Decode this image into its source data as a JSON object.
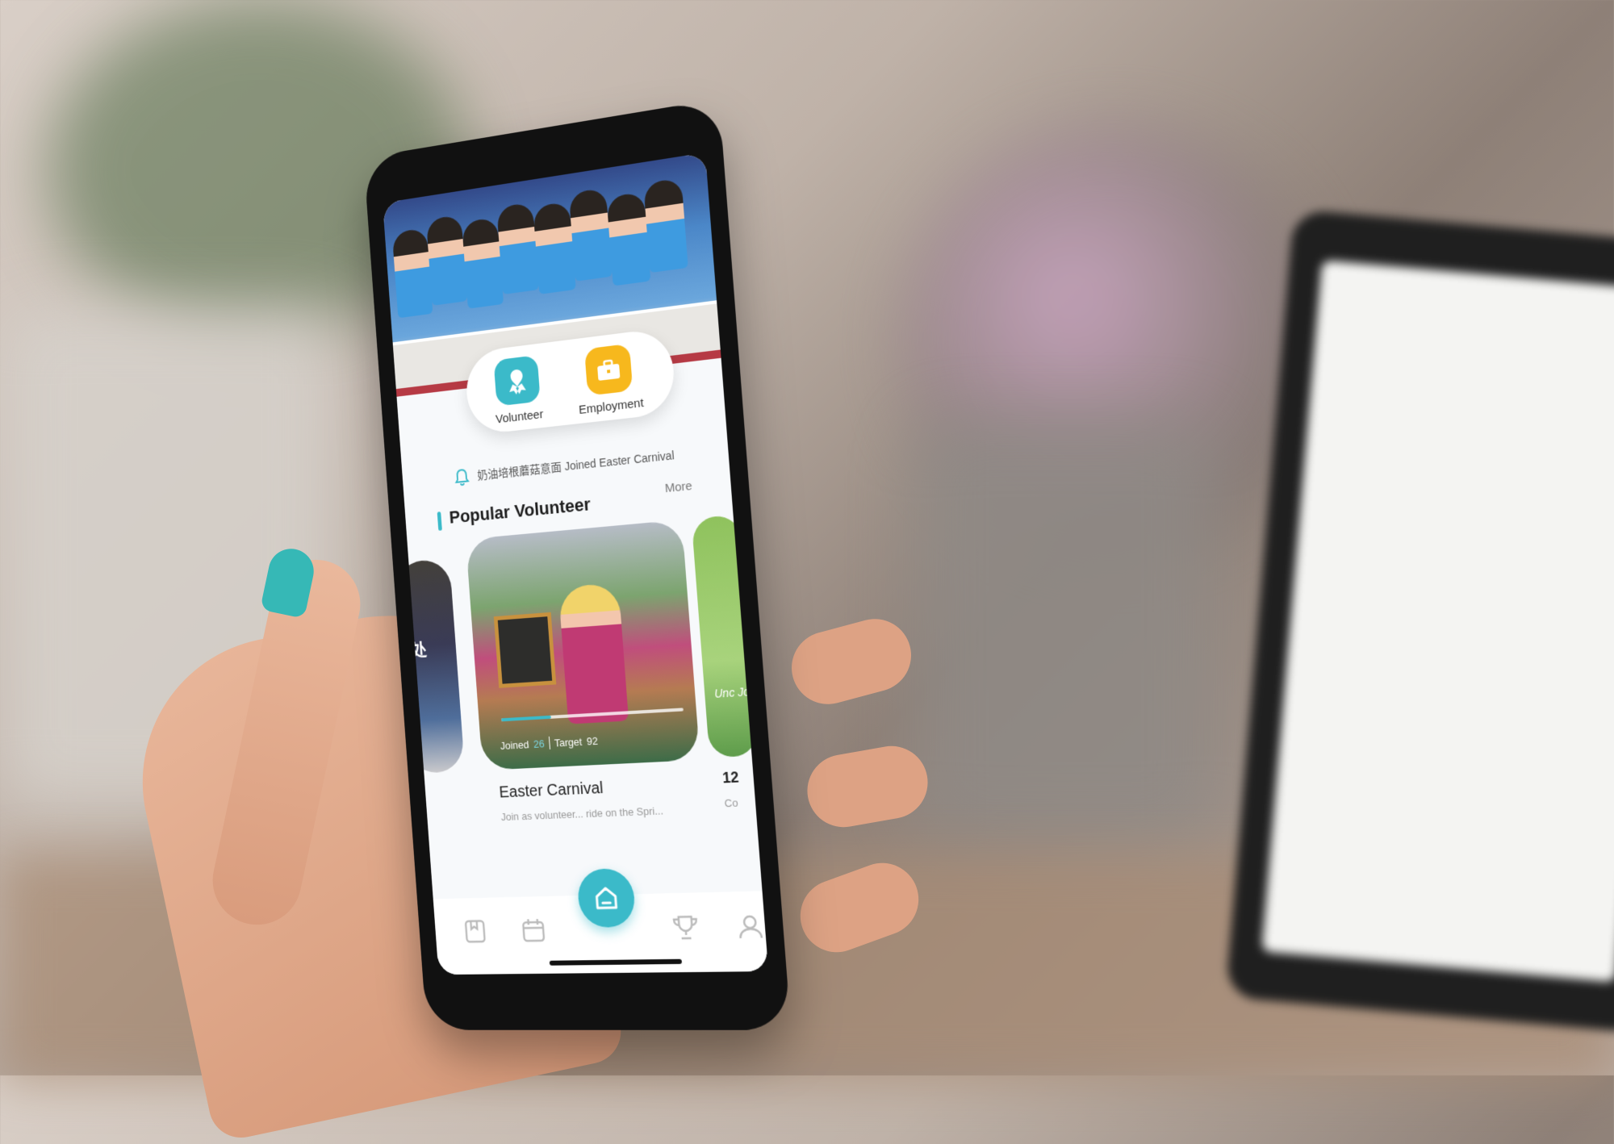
{
  "quick_actions": [
    {
      "label": "Volunteer",
      "icon": "ribbon-icon"
    },
    {
      "label": "Employment",
      "icon": "briefcase-icon"
    }
  ],
  "notice": {
    "icon": "bell-icon",
    "text": "奶油培根蘑菇意面 Joined Easter Carnival"
  },
  "section": {
    "title": "Popular Volunteer",
    "more_label": "More"
  },
  "cards": {
    "left": {
      "overlay_text": "处"
    },
    "main": {
      "joined_label": "Joined",
      "joined_count": "26",
      "target_label": "Target",
      "target_count": "92",
      "progress": 0.28,
      "title": "Easter Carnival",
      "description": "Join as volunteer... ride on the Spri..."
    },
    "right": {
      "overlay_text": "Unc Joi",
      "count_text": "12",
      "sub_text": "Co"
    }
  },
  "tabbar": [
    {
      "name": "bookmark-tab",
      "icon": "bookmark-icon"
    },
    {
      "name": "calendar-tab",
      "icon": "calendar-icon"
    },
    {
      "name": "home-tab",
      "icon": "home-icon",
      "active": true
    },
    {
      "name": "trophy-tab",
      "icon": "trophy-icon"
    },
    {
      "name": "profile-tab",
      "icon": "person-icon"
    }
  ],
  "colors": {
    "accent": "#3bbac9",
    "employment": "#f7b81d"
  }
}
